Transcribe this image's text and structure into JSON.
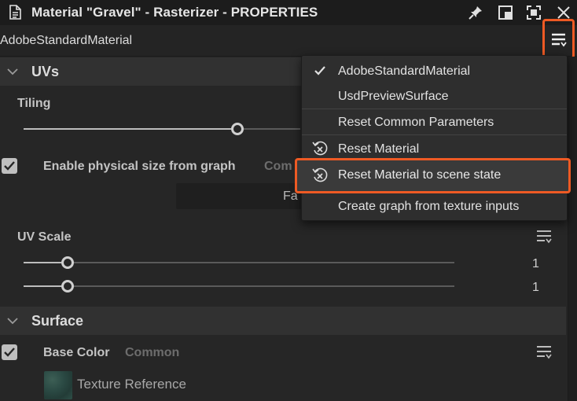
{
  "titlebar": {
    "title": "Material \"Gravel\" - Rasterizer - PROPERTIES",
    "icons": [
      "document-icon",
      "pin-icon",
      "dock-icon",
      "maximize-icon",
      "close-icon"
    ]
  },
  "material_bar": {
    "name": "AdobeStandardMaterial",
    "menu_icon": "hamburger-menu-icon",
    "highlight_color": "#ee5a24"
  },
  "sections": {
    "uvs": {
      "label": "UVs"
    },
    "surface": {
      "label": "Surface"
    }
  },
  "uvs": {
    "tiling_label": "Tiling",
    "physical_size_label": "Enable physical size from graph",
    "physical_size_tag": "Com",
    "physical_size_checked": true,
    "field_value": "Fa",
    "uv_scale_label": "UV Scale",
    "uv_scale_values": [
      "1",
      "1"
    ]
  },
  "surface": {
    "base_color_label": "Base Color",
    "base_color_tag": "Common",
    "base_color_checked": true,
    "texture_label": "Texture Reference"
  },
  "dropdown": {
    "items": [
      {
        "label": "AdobeStandardMaterial",
        "icon": "check-icon",
        "checked": true
      },
      {
        "label": "UsdPreviewSurface",
        "icon": "",
        "checked": false
      },
      {
        "label": "Reset Common Parameters",
        "icon": ""
      },
      {
        "label": "Reset Material",
        "icon": "reset-icon"
      },
      {
        "label": "Reset Material to scene state",
        "icon": "reset-icon",
        "highlighted": true
      },
      {
        "label": "Create graph from texture inputs",
        "icon": ""
      }
    ]
  }
}
